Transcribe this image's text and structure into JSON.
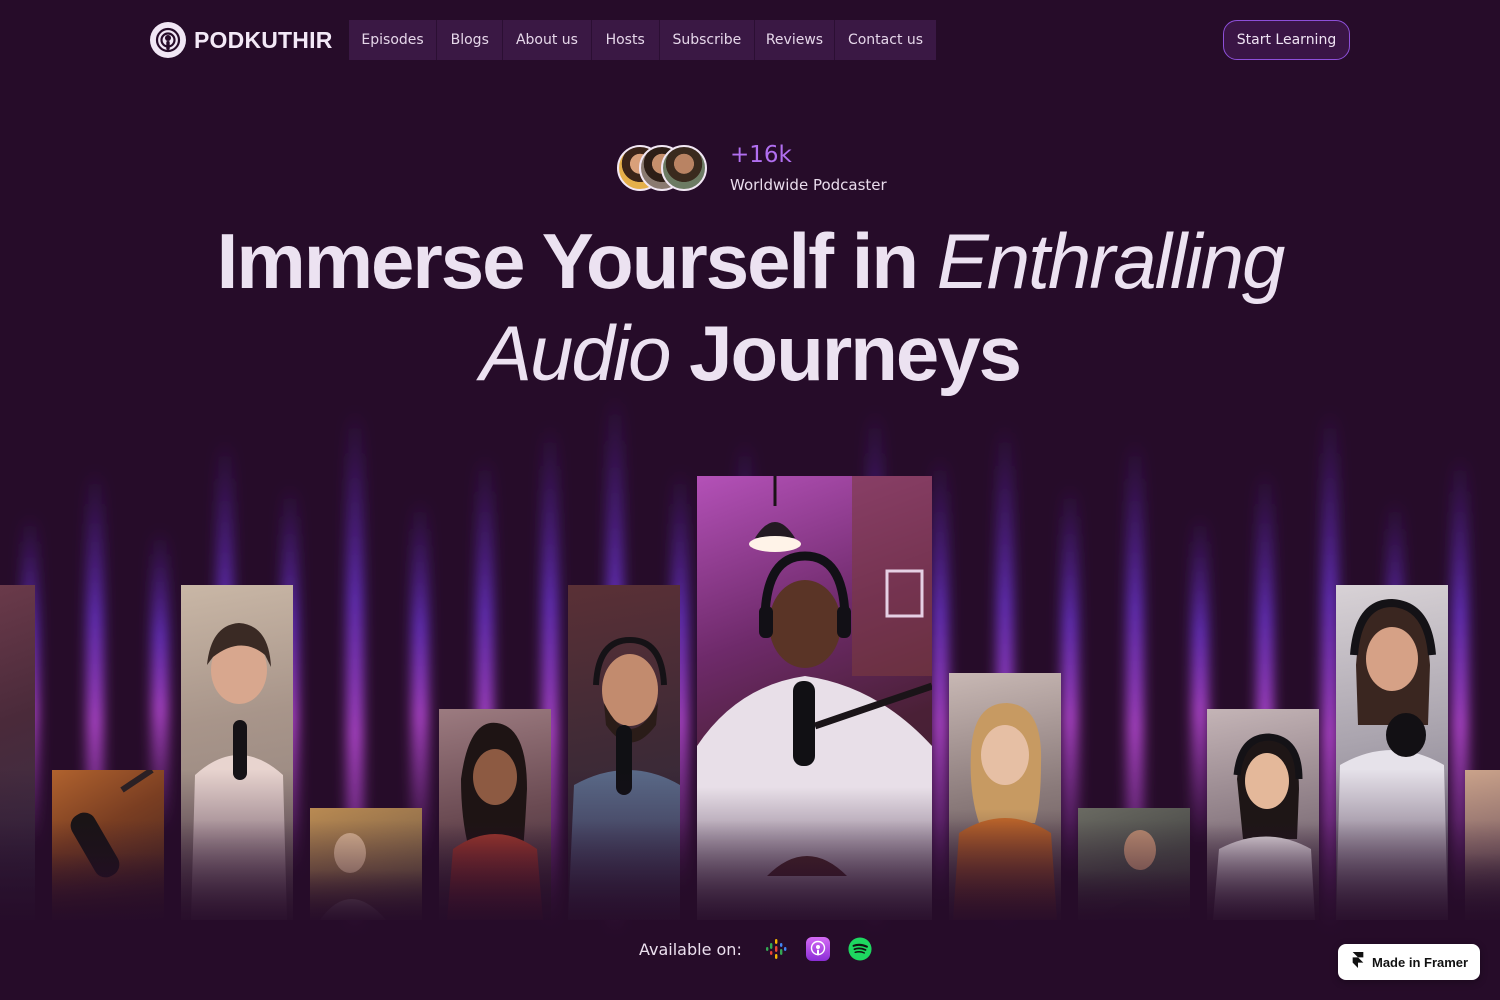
{
  "brand": {
    "name": "PODKUTHIR",
    "icon": "podcast-icon"
  },
  "nav": {
    "items": [
      {
        "label": "Episodes"
      },
      {
        "label": "Blogs"
      },
      {
        "label": "About us"
      },
      {
        "label": "Hosts"
      },
      {
        "label": "Subscribe"
      },
      {
        "label": "Reviews"
      },
      {
        "label": "Contact us"
      }
    ]
  },
  "cta": {
    "label": "Start Learning"
  },
  "social_proof": {
    "count": "+16k",
    "label": "Worldwide Podcaster"
  },
  "headline": {
    "part1": "Immerse Yourself in",
    "part2": "Enthralling",
    "part3": "Audio",
    "part4": "Journeys"
  },
  "availability": {
    "label": "Available on:",
    "platforms": [
      {
        "icon": "google-podcasts-icon"
      },
      {
        "icon": "apple-podcasts-icon"
      },
      {
        "icon": "spotify-icon"
      }
    ]
  },
  "badge": {
    "label": "Made in Framer",
    "icon": "framer-icon"
  },
  "colors": {
    "background": "#260c29",
    "accent": "#b16ff0",
    "nav_bg": "#3a1844",
    "cta_border": "#8d4fd8"
  }
}
